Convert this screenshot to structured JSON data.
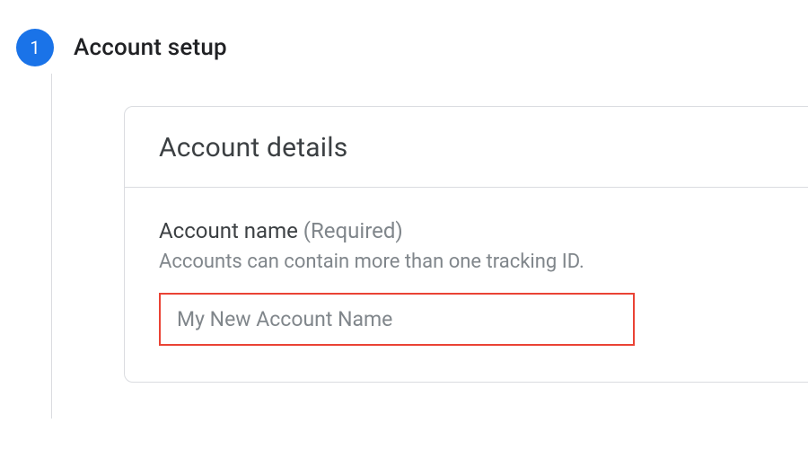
{
  "step": {
    "number": "1",
    "title": "Account setup"
  },
  "card": {
    "header_title": "Account details",
    "field": {
      "label": "Account name",
      "required_text": "(Required)",
      "helper": "Accounts can contain more than one tracking ID.",
      "placeholder": "My New Account Name"
    }
  }
}
